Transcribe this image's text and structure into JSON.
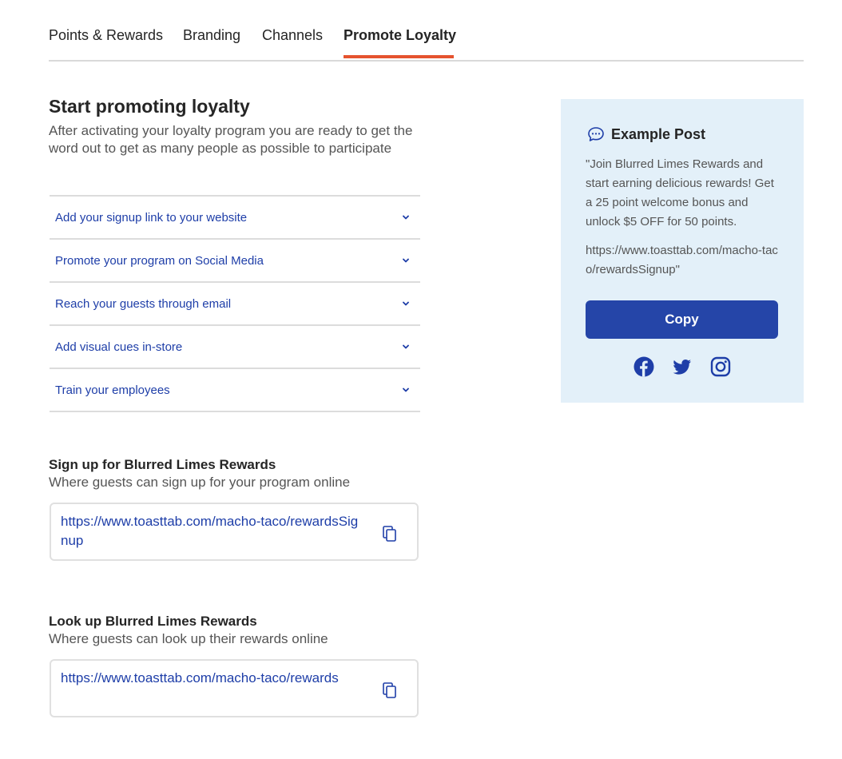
{
  "tabs": [
    {
      "label": "Points & Rewards",
      "active": false
    },
    {
      "label": "Branding",
      "active": false
    },
    {
      "label": "Channels",
      "active": false
    },
    {
      "label": "Promote Loyalty",
      "active": true
    }
  ],
  "intro": {
    "title": "Start promoting loyalty",
    "description": "After activating your loyalty program you are ready to get the word out to get as many people as possible to participate"
  },
  "accordion": [
    {
      "label": "Add your signup link to your website",
      "icon": "chevron-down-icon"
    },
    {
      "label": "Promote your program on Social Media",
      "icon": "chevron-down-icon"
    },
    {
      "label": "Reach your guests through email",
      "icon": "chevron-down-icon"
    },
    {
      "label": "Add visual cues in-store",
      "icon": "chevron-down-icon"
    },
    {
      "label": "Train your employees",
      "icon": "chevron-down-icon"
    }
  ],
  "signup": {
    "title": "Sign up for Blurred Limes Rewards",
    "description": "Where guests can sign up for your program online",
    "url": "https://www.toasttab.com/macho-taco/rewardsSignup"
  },
  "lookup": {
    "title": "Look up Blurred Limes Rewards",
    "description": "Where guests can look up their rewards online",
    "url": "https://www.toasttab.com/macho-taco/rewards"
  },
  "example_post": {
    "title": "Example Post",
    "body": "\"Join Blurred Limes Rewards and start earning delicious rewards! Get a 25 point welcome bonus and unlock $5 OFF for 50 points.",
    "link": "https://www.toasttab.com/macho-taco/rewardsSignup\"",
    "copy_label": "Copy",
    "social_icons": [
      "facebook-icon",
      "twitter-icon",
      "instagram-icon"
    ]
  },
  "colors": {
    "accent": "#e5532e",
    "link": "#1e3ea8",
    "button": "#2545a8",
    "panel_bg": "#e3f0f9"
  }
}
